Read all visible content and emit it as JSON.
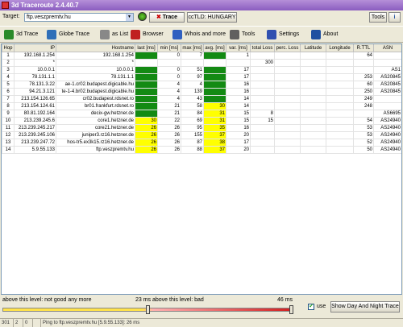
{
  "app": {
    "title": "3d Traceroute 2.4.40.7"
  },
  "target": {
    "label": "Target:",
    "value": "ftp.veszpremtv.hu"
  },
  "buttons": {
    "trace": "Trace",
    "cctld": "ccTLD: HUNGARY",
    "tools_menu": "Tools"
  },
  "toolbar": [
    {
      "label": "3d Trace",
      "icon": "3d-trace-icon",
      "color": "#2a8a2a"
    },
    {
      "label": "Globe Trace",
      "icon": "globe-icon",
      "color": "#2f6fb8"
    },
    {
      "label": "as List",
      "icon": "list-icon",
      "color": "#888888"
    },
    {
      "label": "Browser",
      "icon": "browser-icon",
      "color": "#c02020"
    },
    {
      "label": "Whois and more",
      "icon": "whois-icon",
      "color": "#3060c0"
    },
    {
      "label": "Tools",
      "icon": "tools-icon",
      "color": "#606060"
    },
    {
      "label": "Settings",
      "icon": "settings-icon",
      "color": "#3050b0"
    },
    {
      "label": "About",
      "icon": "about-icon",
      "color": "#2050a0"
    }
  ],
  "table": {
    "columns": [
      "Hop",
      "IP",
      "Hostname",
      "last [ms]",
      "min [ms]",
      "max [ms]",
      "avg. [ms]",
      "var. [ms]",
      "total Loss",
      "perc. Loss",
      "Latitude",
      "Longitude",
      "R.TTL",
      "ASN"
    ],
    "rows": [
      [
        "1",
        "192.168.1.254",
        "192.168.1.254",
        "",
        "0",
        "7",
        "",
        "1",
        "",
        "",
        "",
        "",
        "64",
        ""
      ],
      [
        "2",
        "*",
        "*",
        "",
        "",
        "",
        "",
        "",
        "300",
        "",
        "",
        "",
        "",
        ""
      ],
      [
        "3",
        "10.0.0.1",
        "10.0.0.1",
        "",
        "0",
        "51",
        "",
        "17",
        "",
        "",
        "",
        "",
        "",
        "AS1"
      ],
      [
        "4",
        "78.131.1.1",
        "78.131.1.1",
        "",
        "0",
        "97",
        "",
        "17",
        "",
        "",
        "",
        "",
        "253",
        "AS20845"
      ],
      [
        "5",
        "78.131.3.22",
        "ae-1.cr02.budapest.digicable.hu",
        "",
        "4",
        "4",
        "",
        "16",
        "",
        "",
        "",
        "",
        "60",
        "AS20845"
      ],
      [
        "6",
        "94.21.3.121",
        "te-1-4.br02.budapest.digicable.hu",
        "",
        "4",
        "139",
        "",
        "16",
        "",
        "",
        "",
        "",
        "250",
        "AS20845"
      ],
      [
        "7",
        "213.154.126.65",
        "cr02.budapest.rdsnet.ro",
        "",
        "4",
        "43",
        "",
        "14",
        "",
        "",
        "",
        "",
        "249",
        ""
      ],
      [
        "8",
        "213.154.124.61",
        "br01.frankfurt.rdsnet.ro",
        "",
        "21",
        "58",
        "30",
        "14",
        "",
        "",
        "",
        "",
        "248",
        ""
      ],
      [
        "9",
        "80.81.192.164",
        "decix-gw.hetzner.de",
        "",
        "21",
        "84",
        "31",
        "15",
        "8",
        "",
        "",
        "",
        "",
        "AS6695"
      ],
      [
        "10",
        "213.239.245.6",
        "core1.hetzner.de",
        "30",
        "22",
        "69",
        "31",
        "15",
        "15",
        "",
        "",
        "",
        "54",
        "AS24940"
      ],
      [
        "11",
        "213.239.245.217",
        "core21.hetzner.de",
        "26",
        "26",
        "95",
        "35",
        "16",
        "",
        "",
        "",
        "",
        "53",
        "AS24940"
      ],
      [
        "12",
        "213.239.245.106",
        "juniper3.rz16.hetzner.de",
        "26",
        "26",
        "155",
        "37",
        "20",
        "",
        "",
        "",
        "",
        "53",
        "AS24940"
      ],
      [
        "13",
        "213.239.247.72",
        "hos-tr5.ex3k15.rz16.hetzner.de",
        "26",
        "26",
        "87",
        "38",
        "17",
        "",
        "",
        "",
        "",
        "52",
        "AS24940"
      ],
      [
        "14",
        "5.9.55.133",
        "ftp.veszpremtv.hu",
        "26",
        "26",
        "88",
        "37",
        "20",
        "",
        "",
        "",
        "",
        "50",
        "AS24940"
      ]
    ],
    "cell_colors": {
      "green": "#138a13",
      "yellow": "#ffff00"
    }
  },
  "bottom": {
    "left_text": "above this level: not good any more",
    "mid_text": "23 ms above this level: bad",
    "right_ms": "46 ms",
    "use_label": "use",
    "use_checked": true,
    "day_night_button": "Show Day And Night Trace",
    "slider_good": 0.5,
    "slider_bad": 1.0
  },
  "status": {
    "s1": "301",
    "s2": "2",
    "s3": "0",
    "msg": "Ping to ftp.veszpremtv.hu [5.9.55.133]: 26 ms"
  }
}
